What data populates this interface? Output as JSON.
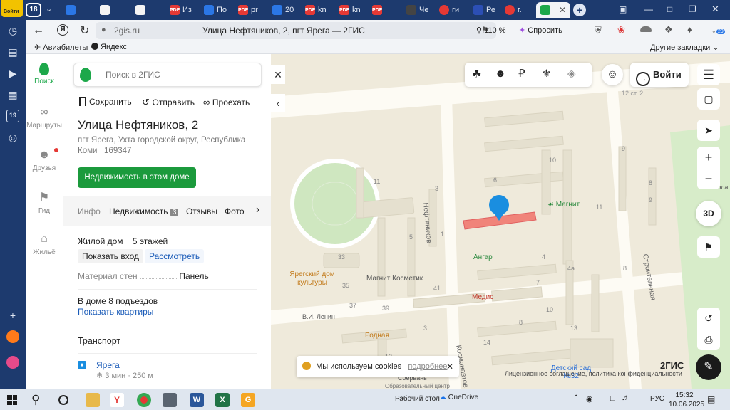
{
  "browser": {
    "tab_count": "18",
    "corner_label": "Войти",
    "tabs": [
      {
        "icon": "",
        "label": ""
      },
      {
        "icon": "",
        "label": ""
      },
      {
        "icon": "PDF",
        "label": "Из"
      },
      {
        "icon": "",
        "label": "По"
      },
      {
        "icon": "PDF",
        "label": "pr"
      },
      {
        "icon": "",
        "label": "20"
      },
      {
        "icon": "PDF",
        "label": "kn"
      },
      {
        "icon": "PDF",
        "label": "kn"
      },
      {
        "icon": "PDF",
        "label": ""
      },
      {
        "icon": "",
        "label": "Че"
      },
      {
        "icon": "",
        "label": "ги"
      },
      {
        "icon": "",
        "label": "Ре"
      },
      {
        "icon": "",
        "label": "г."
      }
    ],
    "address_domain": "2gis.ru",
    "page_title": "Улица Нефтяников, 2, пгт Ярега — 2ГИС",
    "zoom": "110 %",
    "ask_label": "Спросить",
    "download_badge": "29",
    "bookmarks": [
      "Авиабилеты",
      "Яндекс"
    ],
    "other_bookmarks": "Другие закладки",
    "sidebar_badge": "19"
  },
  "rail": {
    "items": [
      {
        "label": "Поиск"
      },
      {
        "label": "Маршруты"
      },
      {
        "label": "Друзья"
      },
      {
        "label": "Гид"
      },
      {
        "label": "Жильё"
      }
    ]
  },
  "panel": {
    "search_placeholder": "Поиск в 2ГИС",
    "actions": [
      "Сохранить",
      "Отправить",
      "Проехать"
    ],
    "title": "Улица Нефтяников, 2",
    "address": "пгт Ярега, Ухта городской округ, Республика Коми",
    "postcode": "169347",
    "realty_button": "Недвижимость в этом доме",
    "tabs": [
      "Инфо",
      "Недвижимость",
      "Отзывы",
      "Фото"
    ],
    "realty_count": "3",
    "building_type": "Жилой дом",
    "floors": "5 этажей",
    "show_entrance": "Показать вход",
    "view_label": "Рассмотреть",
    "wall_label": "Материал стен",
    "wall_value": "Панель",
    "entrances": "В доме 8 подъездов",
    "show_flats": "Показать квартиры",
    "transport_heading": "Транспорт",
    "stop_name": "Ярега",
    "stop_distance": "3 мин · 250 м"
  },
  "map": {
    "login_label": "Войти",
    "threed_label": "3D",
    "cookie_text": "Мы используем cookies",
    "cookie_more": "подробнее",
    "license_text": "Лицензионное соглашение, политика конфиденциальности",
    "brand": "2ГИС",
    "street_labels": [
      "Нефтяников",
      "Строительная",
      "Космонавтов",
      "12 ст. 2"
    ],
    "poi_labels": [
      "Магнит",
      "Ангар",
      "Магнит Косметик",
      "Медис",
      "Ярегский дом культуры",
      "Родная",
      "Детский сад №32",
      "В.И. Ленин",
      "Школа",
      "Соервань",
      "Образовательный центр"
    ],
    "house_numbers": [
      "10",
      "9",
      "8",
      "11",
      "3",
      "6",
      "1",
      "5",
      "4",
      "4а",
      "7",
      "9",
      "8",
      "11",
      "10",
      "13",
      "41",
      "35",
      "37",
      "33",
      "39",
      "8",
      "3",
      "12",
      "14"
    ]
  },
  "taskbar": {
    "desktop_label": "Рабочий стол",
    "onedrive": "OneDrive",
    "lang": "РУС",
    "time": "15:32",
    "date": "10.06.2025"
  }
}
